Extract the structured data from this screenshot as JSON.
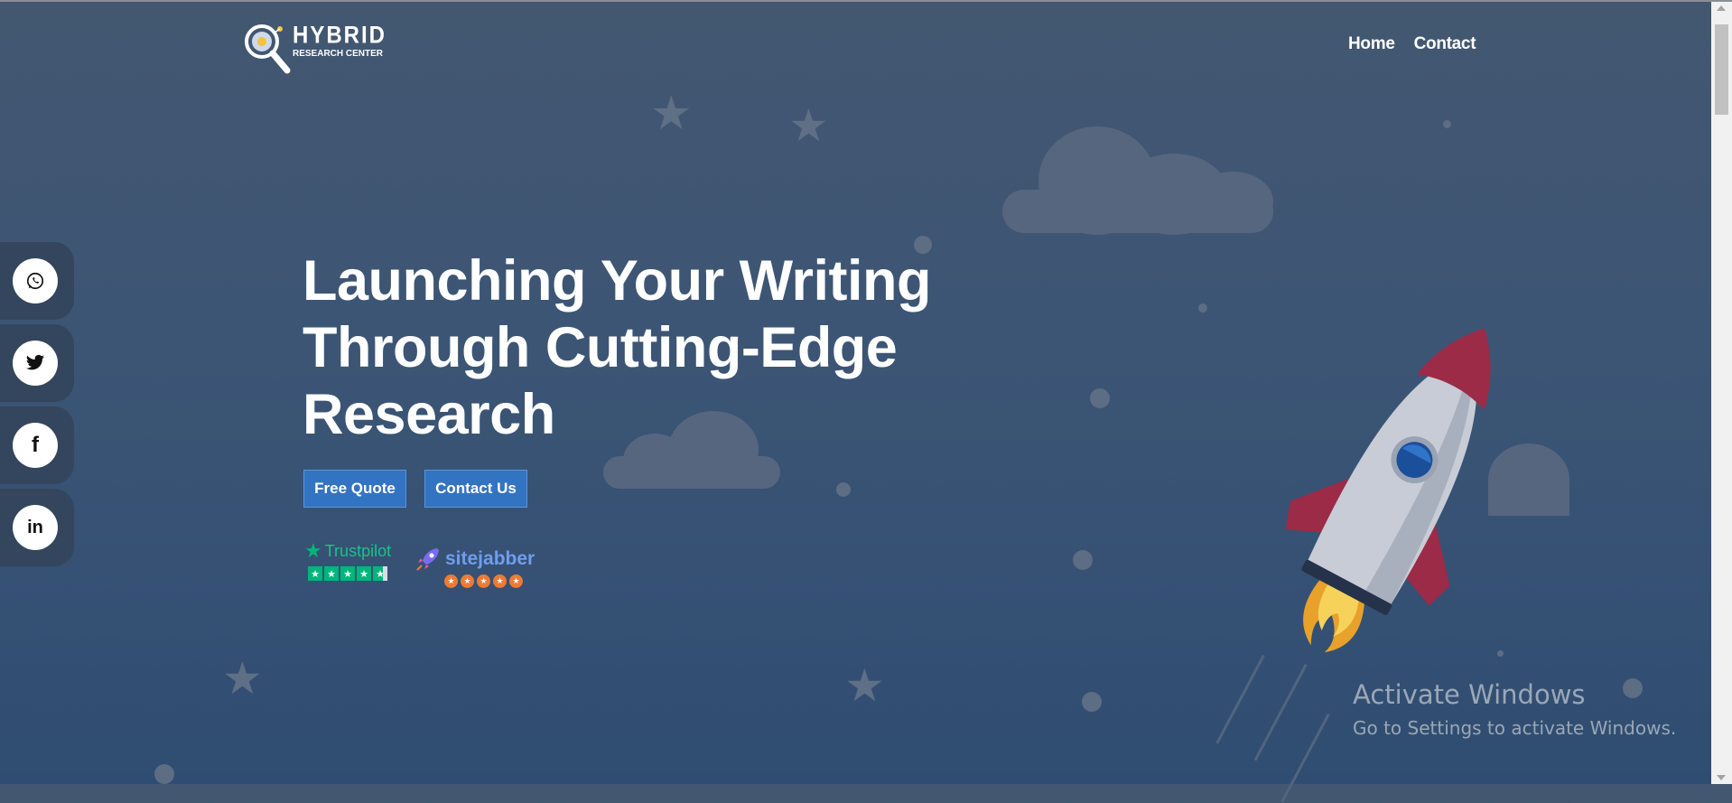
{
  "brand": {
    "name": "HYBRID",
    "tagline": "RESEARCH CENTER"
  },
  "nav": {
    "home": "Home",
    "contact": "Contact"
  },
  "social": [
    {
      "name": "whatsapp",
      "icon": "whatsapp-icon",
      "glyph": "✆"
    },
    {
      "name": "twitter",
      "icon": "twitter-icon",
      "glyph": "🐦"
    },
    {
      "name": "facebook",
      "icon": "facebook-icon",
      "glyph": "f"
    },
    {
      "name": "linkedin",
      "icon": "linkedin-icon",
      "glyph": "in"
    }
  ],
  "hero": {
    "title_line1": "Launching Your Writing",
    "title_line2": "Through Cutting-Edge",
    "title_line3": "Research",
    "free_quote": "Free Quote",
    "contact_us": "Contact Us"
  },
  "ratings": {
    "trustpilot": "Trustpilot",
    "sitejabber": "sitejabber"
  },
  "watermark": {
    "title": "Activate Windows",
    "subtitle": "Go to Settings to activate Windows."
  },
  "colors": {
    "button": "#3374c2",
    "trustpilot_green": "#00b67a",
    "sitejabber_orange": "#ef7a30"
  }
}
